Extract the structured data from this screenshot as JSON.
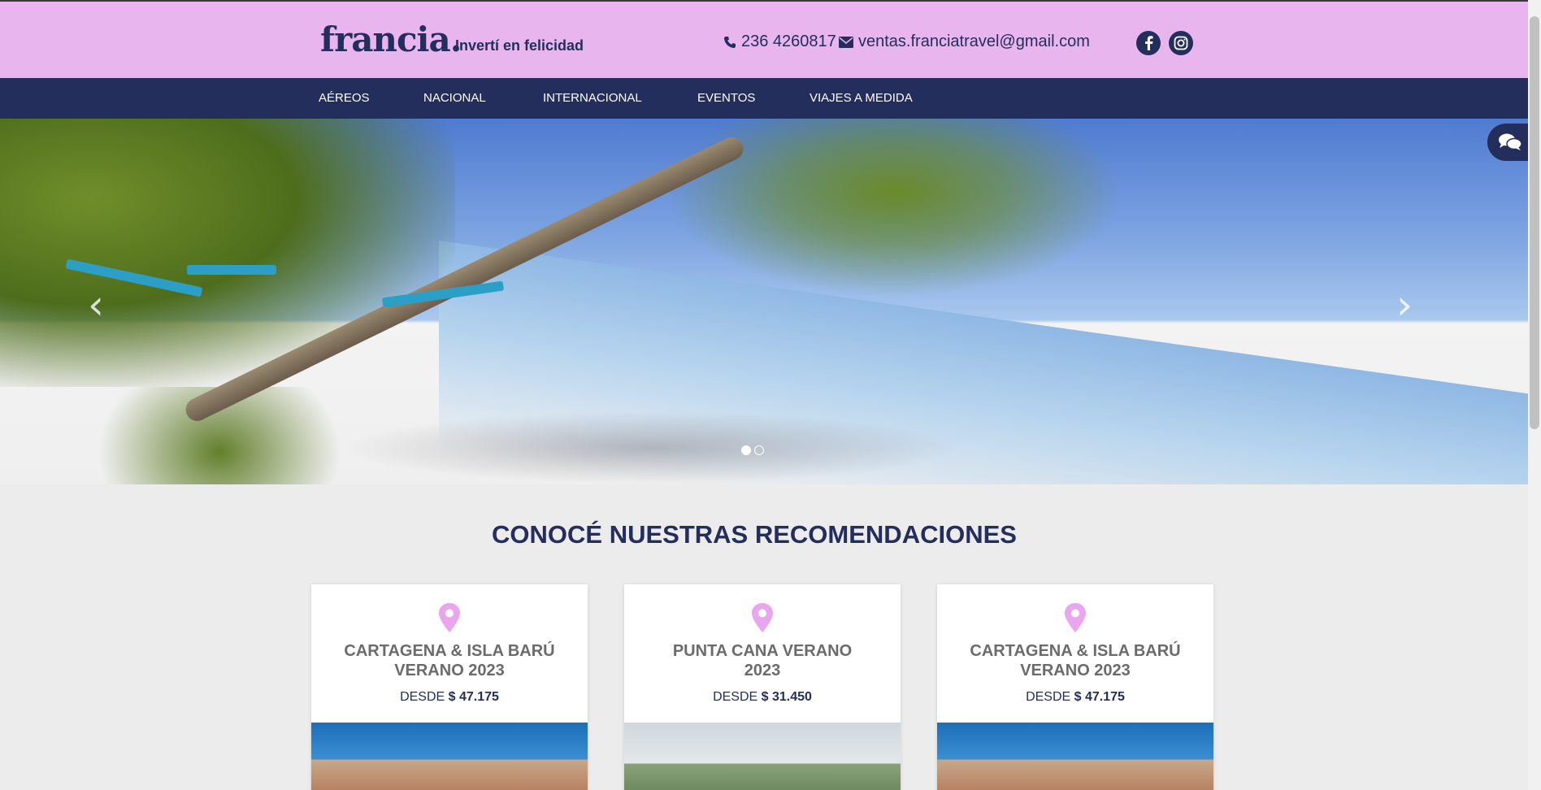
{
  "header": {
    "logo": "francia.",
    "tagline": "Invertí en felicidad",
    "phone": "236 4260817",
    "email": "ventas.franciatravel@gmail.com"
  },
  "nav": {
    "items": [
      "AÉREOS",
      "NACIONAL",
      "INTERNACIONAL",
      "EVENTOS",
      "VIAJES A MEDIDA"
    ]
  },
  "hero": {
    "prev_arrow": "‹",
    "next_arrow": "›",
    "slide_count": 2,
    "active_slide": 1
  },
  "recommendations": {
    "title": "CONOCÉ NUESTRAS RECOMENDACIONES",
    "cards": [
      {
        "title_line1": "CARTAGENA & ISLA BARÚ",
        "title_line2": "VERANO 2023",
        "price_prefix": "DESDE",
        "price": "$ 47.175"
      },
      {
        "title_line1": "PUNTA CANA VERANO",
        "title_line2": "2023",
        "price_prefix": "DESDE",
        "price": "$ 31.450"
      },
      {
        "title_line1": "CARTAGENA & ISLA BARÚ",
        "title_line2": "VERANO 2023",
        "price_prefix": "DESDE",
        "price": "$ 47.175"
      }
    ]
  },
  "colors": {
    "header_bg": "#e9b5ee",
    "nav_bg": "#232e5c",
    "accent_pink": "#e9a6ee",
    "brand_navy": "#232e5c"
  },
  "icons": [
    "phone-icon",
    "envelope-icon",
    "facebook-icon",
    "instagram-icon",
    "chat-icon",
    "map-pin-icon"
  ]
}
